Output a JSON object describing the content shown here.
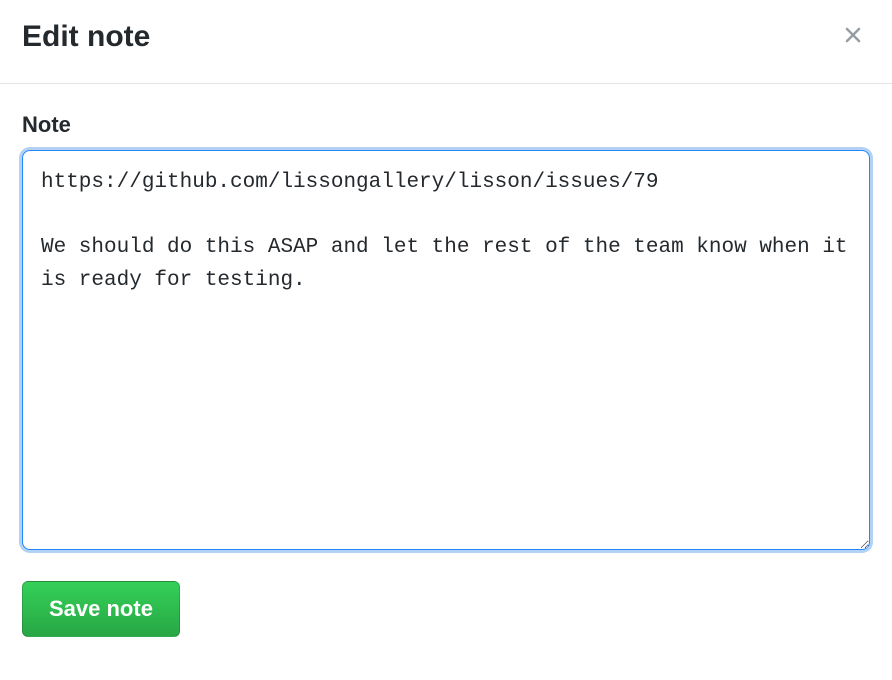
{
  "modal": {
    "title": "Edit note",
    "field_label": "Note",
    "note_value": "https://github.com/lissongallery/lisson/issues/79\n\nWe should do this ASAP and let the rest of the team know when it is ready for testing.",
    "save_label": "Save note"
  }
}
